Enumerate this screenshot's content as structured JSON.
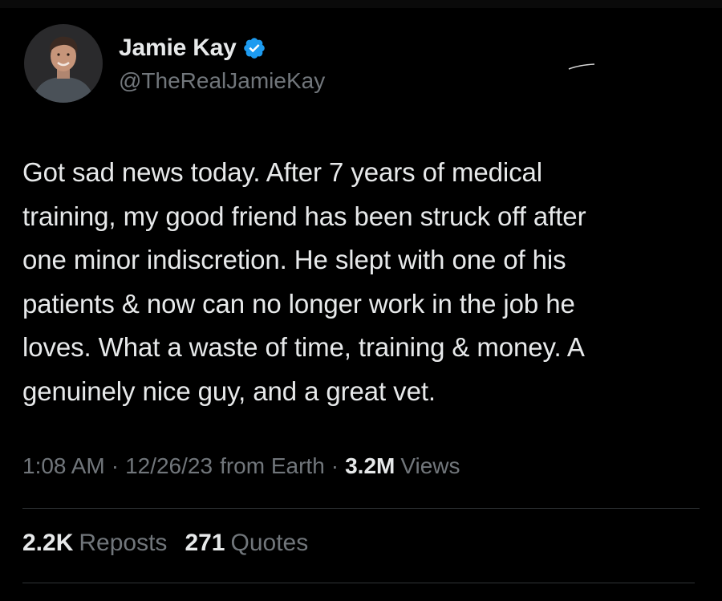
{
  "author": {
    "display_name": "Jamie Kay",
    "handle": "@TheRealJamieKay",
    "verified_icon": "verified-badge-icon",
    "avatar_icon": "avatar"
  },
  "tweet": {
    "text": "Got sad news today. After 7 years of medical\ntraining, my good friend has been struck off after\none minor indiscretion. He slept with one of his\npatients & now can no longer work in the job he\nloves. What a waste of time, training & money. A\ngenuinely nice guy, and a great vet."
  },
  "meta": {
    "time": "1:08 AM",
    "date": "12/26/23",
    "source": "from Earth",
    "views_count": "3.2M",
    "views_label": "Views",
    "separator": "·"
  },
  "stats": {
    "reposts_count": "2.2K",
    "reposts_label": "Reposts",
    "quotes_count": "271",
    "quotes_label": "Quotes"
  },
  "colors": {
    "background": "#000000",
    "primary_text": "#e7e9ea",
    "secondary_text": "#71767b",
    "verified_blue": "#1d9bf0",
    "divider": "#2f3336"
  }
}
